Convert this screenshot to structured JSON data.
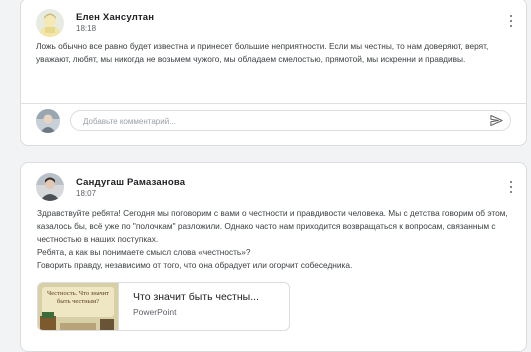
{
  "posts": [
    {
      "author": "Елен Хансултан",
      "time": "18:18",
      "text": "Ложь обычно все равно будет известна и принесет большие неприятности. Если мы честны, то  нам доверяют, верят, уважают, любят, мы никогда не возьмем чужого, мы обладаем смелостью, прямотой, мы искренни и правдивы.",
      "comment_placeholder": "Добавьте комментарий..."
    },
    {
      "author": "Сандугаш Рамазанова",
      "time": "18:07",
      "paragraphs": [
        "Здравствуйте ребята! Сегодня мы поговорим с вами о честности и правдивости человека. Мы с детства говорим об этом, казалось бы, всё уже по \"полочкам\" разложили. Однако часто нам приходится возвращаться к вопросам, связанным с честностью в наших поступках.",
        " Ребята, а как вы понимаете смысл слова «честность»?",
        "Говорить правду, независимо от того, что она обрадует или огорчит собеседника."
      ],
      "attachment": {
        "title": "Что значит быть честны...",
        "type": "PowerPoint",
        "thumb_text": "Честность. Что значит быть честным?"
      }
    }
  ],
  "icons": {
    "more": "more-vert-icon",
    "send": "send-icon"
  },
  "colors": {
    "background": "#f1f3f4",
    "card": "#ffffff",
    "border": "#dadce0",
    "secondary_text": "#5f6368"
  }
}
